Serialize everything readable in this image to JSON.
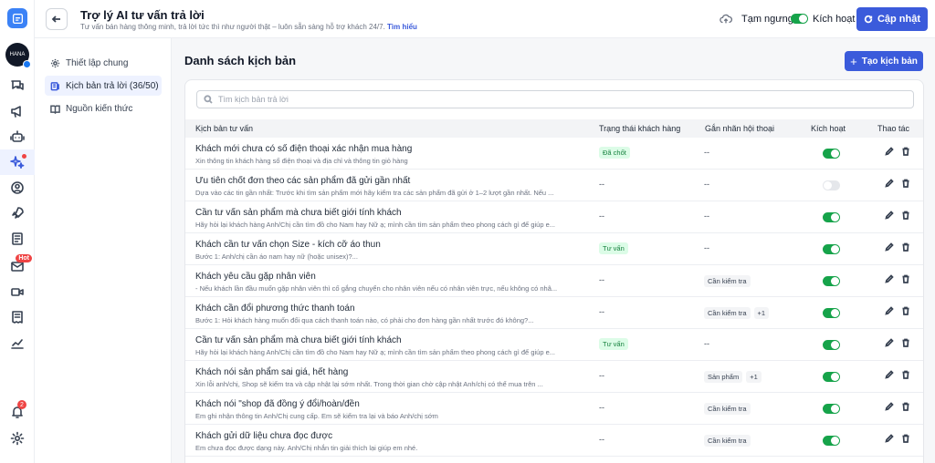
{
  "header": {
    "title": "Trợ lý AI tư vấn trả lời",
    "subtitle": "Tư vấn bán hàng thông minh, trả lời tức thì như người thật – luôn sẵn sàng hỗ trợ khách 24/7.",
    "learn_more": "Tìm hiểu",
    "pause_label": "Tạm ngưng",
    "active_label": "Kích hoạt",
    "update_button": "Cập nhật"
  },
  "rail": {
    "avatar_text": "HANA",
    "hot_badge": "Hot",
    "notification_count": "2"
  },
  "subnav": {
    "items": [
      {
        "label": "Thiết lập chung",
        "icon": "gear-icon",
        "active": false
      },
      {
        "label": "Kịch bản trả lời (36/50)",
        "icon": "script-icon",
        "active": true
      },
      {
        "label": "Nguồn kiến thức",
        "icon": "book-icon",
        "active": false
      }
    ]
  },
  "main": {
    "title": "Danh sách kịch bản",
    "create_button": "Tạo kịch bản",
    "search_placeholder": "Tìm kịch bản trả lời",
    "columns": {
      "name": "Kịch bản tư vấn",
      "status": "Trạng thái khách hàng",
      "tags": "Gắn nhãn hội thoại",
      "active": "Kích hoạt",
      "actions": "Thao tác"
    },
    "rows": [
      {
        "title": "Khách mới chưa có số điện thoại xác nhận mua hàng",
        "desc": "Xin thông tin khách hàng số điện thoại và địa chỉ và thông tin giỏ hàng",
        "status": "Đã chốt",
        "status_badge": true,
        "tags": [],
        "tags_empty": "--",
        "active": true
      },
      {
        "title": "Ưu tiên chốt đơn theo các sản phẩm đã gửi gần nhất",
        "desc": "Dựa vào các tin gần nhất: Trước khi tìm sản phẩm mới hãy kiểm tra các sản phẩm đã gửi ở 1–2 lượt gần nhất. Nếu ...",
        "status": "--",
        "status_badge": false,
        "tags": [],
        "tags_empty": "--",
        "active": false
      },
      {
        "title": "Cần tư vấn sản phẩm mà chưa biết giới tính khách",
        "desc": "Hãy hỏi lại khách hàng Anh/Chị cần tìm đồ cho Nam hay Nữ ạ; mình cần tìm sản phẩm theo phong cách gì để giúp e...",
        "status": "--",
        "status_badge": false,
        "tags": [],
        "tags_empty": "--",
        "active": true
      },
      {
        "title": "Khách cần tư vấn chọn Size - kích cỡ áo thun",
        "desc": "Bước 1:    Anh/chị cần áo nam hay nữ (hoặc unisex)?...",
        "status": "Tư vấn",
        "status_badge": true,
        "tags": [],
        "tags_empty": "--",
        "active": true
      },
      {
        "title": "Khách yêu cầu gặp nhân viên",
        "desc": "- Nếu khách lần đầu muốn gặp nhân viên thì cố gắng chuyển cho nhân viên nếu có nhân viên trực, nếu không có nhâ...",
        "status": "--",
        "status_badge": false,
        "tags": [
          "Cần kiểm tra"
        ],
        "tags_empty": "",
        "active": true
      },
      {
        "title": "Khách cần đổi phương thức thanh toán",
        "desc": "Bước 1: Hỏi khách hàng muốn đổi qua cách thanh toán nào, có phải cho đơn hàng gần nhất trước đó không?...",
        "status": "--",
        "status_badge": false,
        "tags": [
          "Cần kiểm tra",
          "+1"
        ],
        "tags_empty": "",
        "active": true
      },
      {
        "title": "Cần tư vấn sản phẩm mà chưa biết giới tính khách",
        "desc": "Hãy hỏi lại khách hàng Anh/Chị cần tìm đồ cho Nam hay Nữ ạ; mình cần tìm sản phẩm theo phong cách gì để giúp e...",
        "status": "Tư vấn",
        "status_badge": true,
        "tags": [],
        "tags_empty": "--",
        "active": true
      },
      {
        "title": "Khách nói sản phẩm sai giá, hết hàng",
        "desc": "Xin lỗi anh/chị, Shop sẽ kiểm tra và cập nhật lại sớm nhất. Trong thời gian chờ cập nhật Anh/chị có thể mua trên ...",
        "status": "--",
        "status_badge": false,
        "tags": [
          "Sản phẩm",
          "+1"
        ],
        "tags_empty": "",
        "active": true
      },
      {
        "title": "Khách nói \"shop đã đồng ý đổi/hoàn/đền",
        "desc": "Em ghi nhận thông tin Anh/Chị cung cấp. Em sẽ kiểm tra lại và báo Anh/chị sớm",
        "status": "--",
        "status_badge": false,
        "tags": [
          "Cần kiểm tra"
        ],
        "tags_empty": "",
        "active": true
      },
      {
        "title": "Khách gửi dữ liệu chưa đọc được",
        "desc": "Em chưa đọc được dạng này. Anh/Chị nhắn tin giải thích lại giúp em nhé.",
        "status": "--",
        "status_badge": false,
        "tags": [
          "Cần kiểm tra"
        ],
        "tags_empty": "",
        "active": true
      }
    ]
  },
  "colors": {
    "primary": "#3b5bdb",
    "toggle_on": "#16a34a",
    "badge_green_bg": "#dcfce7",
    "badge_green_text": "#15803d",
    "alert": "#ef4444"
  }
}
